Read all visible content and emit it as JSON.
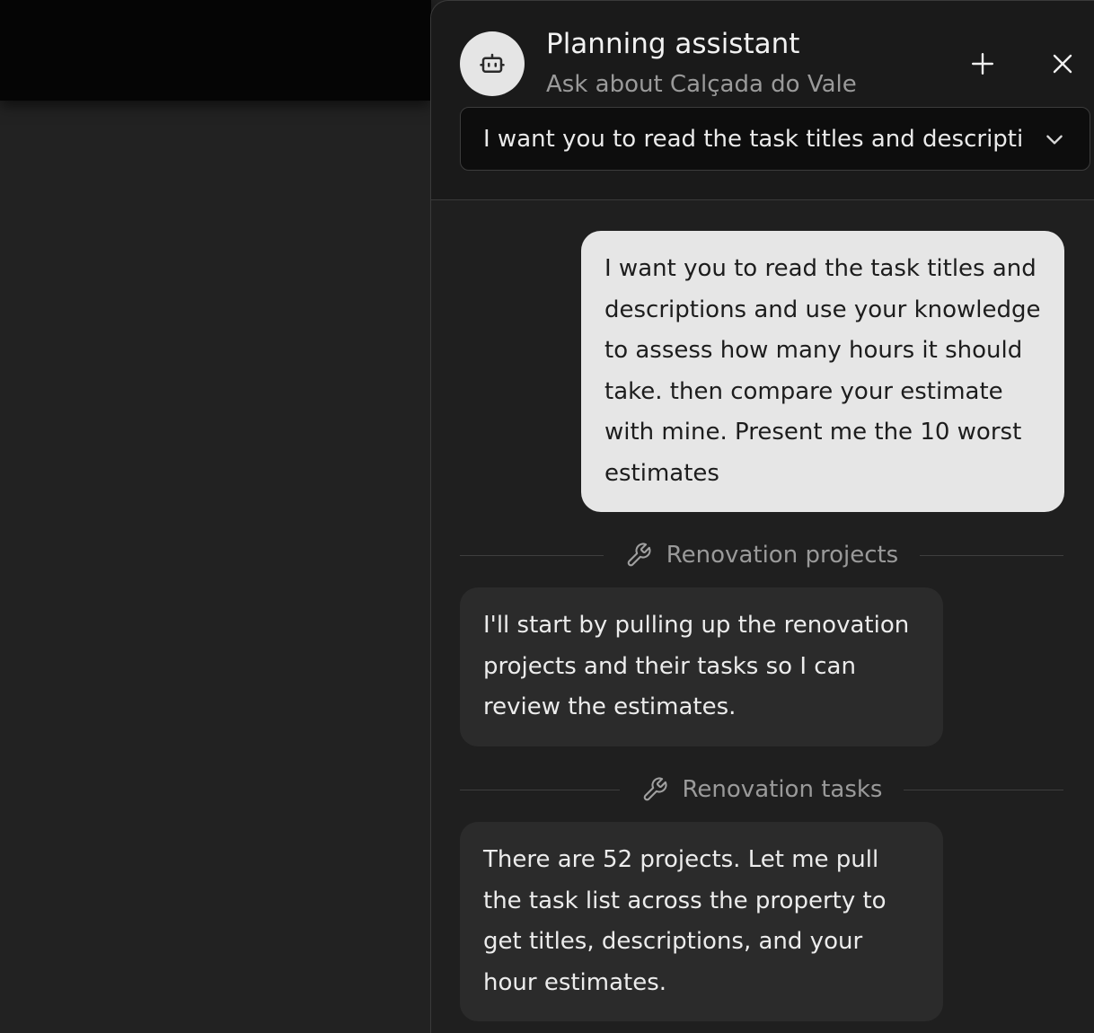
{
  "header": {
    "title": "Planning assistant",
    "subtitle": "Ask about Calçada do Vale",
    "avatar_icon": "robot-icon",
    "new_chat_icon": "plus-icon",
    "close_icon": "close-icon"
  },
  "conversation_select": {
    "selected": "I want you to read the task titles and descriptions and use your knowledge to assess how many hours it should take. then compare your estimate with mine. Present me the 10 worst estimates",
    "chevron_icon": "chevron-down-icon"
  },
  "messages": [
    {
      "role": "user",
      "text": "I want you to read the task titles and descriptions and use your knowledge to assess how many hours it should take. then compare your estimate with mine. Present me the 10 worst estimates"
    },
    {
      "role": "tool",
      "icon": "wrench-icon",
      "label": "Renovation projects"
    },
    {
      "role": "assistant",
      "text": "I'll start by pulling up the renovation projects and their tasks so I can review the estimates."
    },
    {
      "role": "tool",
      "icon": "wrench-icon",
      "label": "Renovation tasks"
    },
    {
      "role": "assistant",
      "text": "There are 52 projects. Let me pull the task list across the property to get titles, descriptions, and your hour estimates."
    }
  ],
  "colors": {
    "user_bubble": "#e6e6e6",
    "assistant_bubble": "#2b2b2b",
    "panel_bg": "#1f1f1f",
    "muted_text": "#9a9a9a"
  }
}
